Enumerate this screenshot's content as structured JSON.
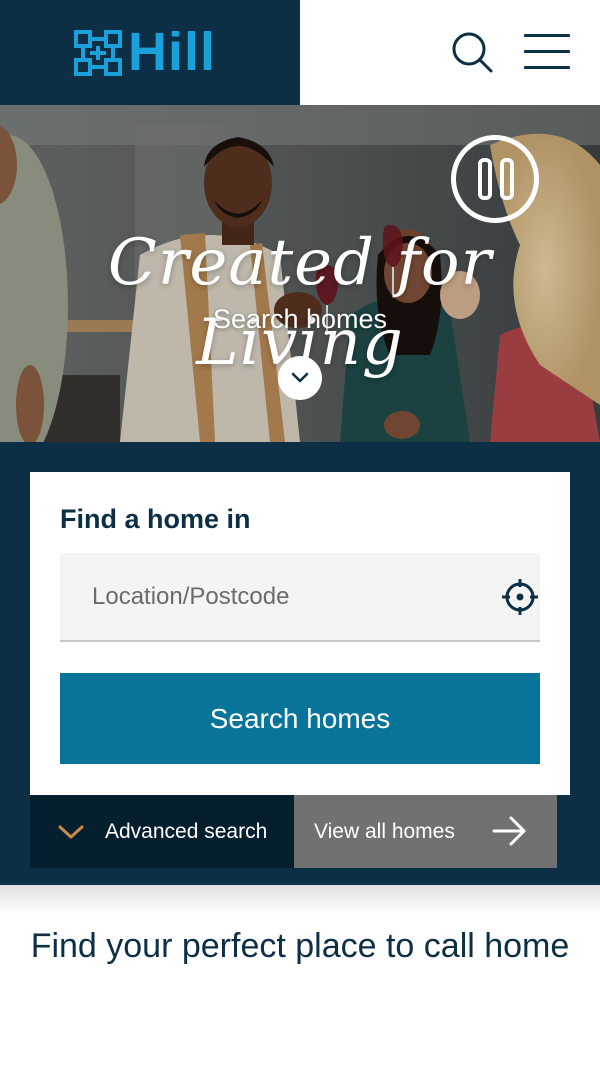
{
  "header": {
    "brand_name": "Hill",
    "brand_color": "#1aa0db",
    "background": "#0c2f45",
    "icons": [
      "hill-logo-mark",
      "search-icon",
      "hamburger-menu-icon"
    ]
  },
  "hero": {
    "tagline": "Created for Living",
    "cta_label": "Search homes",
    "controls": [
      "pause-icon",
      "chevron-down-icon"
    ]
  },
  "search": {
    "title": "Find a home in",
    "location_placeholder": "Location/Postcode",
    "location_value": "",
    "submit_label": "Search homes",
    "advanced_label": "Advanced search",
    "view_all_label": "View all homes",
    "accent_color": "#08749a",
    "advanced_icon_color": "#c8894f"
  },
  "intro": {
    "heading": "Find your perfect place to call home"
  }
}
